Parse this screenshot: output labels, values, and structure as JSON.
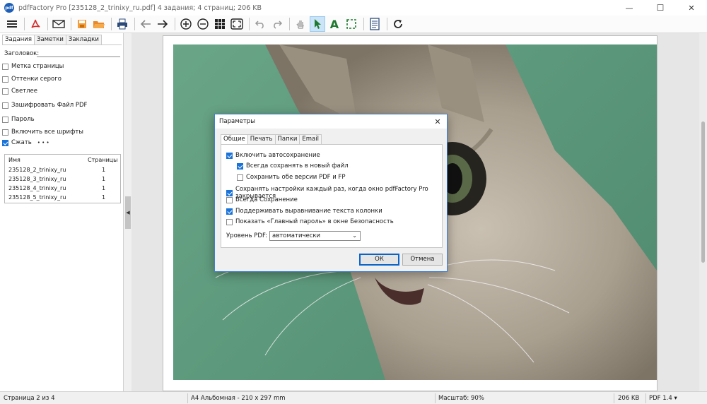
{
  "window": {
    "title": "pdfFactory Pro [235128_2_trinixy_ru.pdf] 4 задания; 4 страниц; 206 KB",
    "app_icon_text": "pdf",
    "minimize_glyph": "—",
    "maximize_glyph": "☐",
    "close_glyph": "✕"
  },
  "toolbar": {
    "icons": [
      "menu-icon",
      "pdf-icon",
      "mail-icon",
      "save-icon",
      "folder-icon",
      "printer-icon",
      "arrow-left-icon",
      "arrow-right-icon",
      "zoom-in-icon",
      "zoom-out-icon",
      "grid-icon",
      "fit-page-icon",
      "undo-icon",
      "redo-icon",
      "hand-icon",
      "pointer-icon",
      "text-tool-icon",
      "select-area-icon",
      "notes-icon",
      "refresh-icon"
    ]
  },
  "left_panel": {
    "tabs": [
      "Задания",
      "Заметки",
      "Закладки"
    ],
    "header_label": "Заголовок:",
    "options": [
      {
        "label": "Метка страницы",
        "checked": false
      },
      {
        "label": "Оттенки серого",
        "checked": false
      },
      {
        "label": "Светлее",
        "checked": false
      },
      {
        "label": "Зашифровать Файл PDF",
        "checked": false
      },
      {
        "label": "Пароль",
        "checked": false
      },
      {
        "label": "Включить все шрифты",
        "checked": false
      },
      {
        "label": "Сжать",
        "checked": true
      }
    ],
    "more_glyph": "• • •",
    "list": {
      "columns": [
        "Имя",
        "Страницы"
      ],
      "rows": [
        {
          "name": "235128_2_trinixy_ru",
          "pages": "1"
        },
        {
          "name": "235128_3_trinixy_ru",
          "pages": "1"
        },
        {
          "name": "235128_4_trinixy_ru",
          "pages": "1"
        },
        {
          "name": "235128_5_trinixy_ru",
          "pages": "1"
        }
      ]
    },
    "collapse_glyph": "◀"
  },
  "dialog": {
    "title": "Параметры",
    "close_glyph": "✕",
    "tabs": [
      "Общие",
      "Печать",
      "Папки",
      "Email"
    ],
    "options": [
      {
        "label": "Включить автосохранение",
        "checked": true
      },
      {
        "label": "Всегда сохранять в новый файл",
        "checked": true
      },
      {
        "label": "Сохранить обе версии PDF и FP",
        "checked": false
      },
      {
        "label": "Сохранять настройки каждый раз, когда окно pdfFactory Pro закрывается",
        "checked": true
      },
      {
        "label": "Всегда Сохранение",
        "checked": false
      },
      {
        "label": "Поддерживать выравнивание текста колонки",
        "checked": true
      },
      {
        "label": "Показать «Главный пароль» в окне Безопасность",
        "checked": false
      }
    ],
    "pdf_level_label": "Уровень PDF:",
    "pdf_level_value": "автоматически",
    "ok_label": "ОК",
    "cancel_label": "Отмена"
  },
  "status": {
    "page": "Страница 2 из 4",
    "paper": "A4 Альбомная - 210 x 297 mm",
    "zoom": "Масштаб: 90%",
    "size": "206 KB",
    "pdf_version": "PDF 1.4 ▾"
  }
}
